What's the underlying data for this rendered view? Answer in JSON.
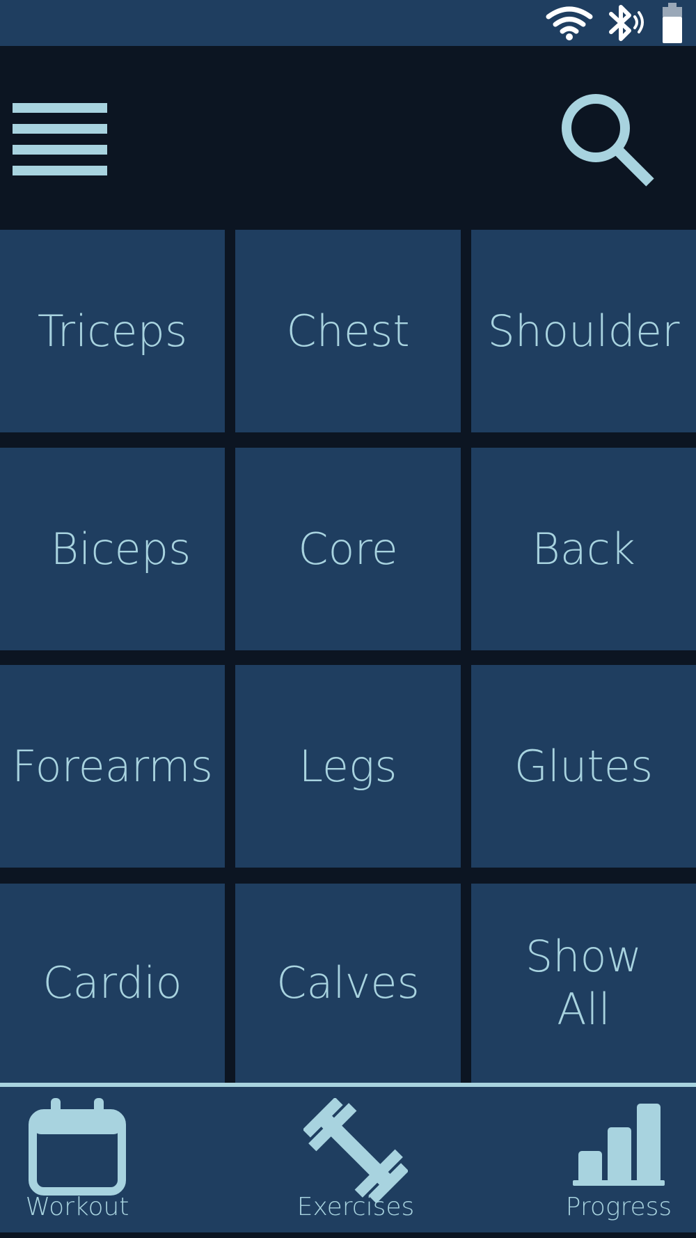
{
  "status_bar": {
    "icons": [
      "wifi-icon",
      "bluetooth-icon",
      "battery-icon"
    ]
  },
  "toolbar": {
    "menu_icon": "hamburger-menu-icon",
    "search_icon": "search-icon"
  },
  "categories": [
    {
      "label": "Triceps"
    },
    {
      "label": "Chest"
    },
    {
      "label": "Shoulder"
    },
    {
      "label": "Biceps"
    },
    {
      "label": "Core"
    },
    {
      "label": "Back"
    },
    {
      "label": "Forearms"
    },
    {
      "label": "Legs"
    },
    {
      "label": "Glutes"
    },
    {
      "label": "Cardio"
    },
    {
      "label": "Calves"
    },
    {
      "label": "Show All"
    }
  ],
  "bottom_nav": {
    "items": [
      {
        "label": "Workout",
        "icon": "calendar-icon"
      },
      {
        "label": "Exercises",
        "icon": "dumbbell-icon"
      },
      {
        "label": "Progress",
        "icon": "bar-chart-icon"
      }
    ]
  },
  "colors": {
    "background": "#0c1522",
    "tile": "#1f3e60",
    "accent": "#a8d3df"
  }
}
